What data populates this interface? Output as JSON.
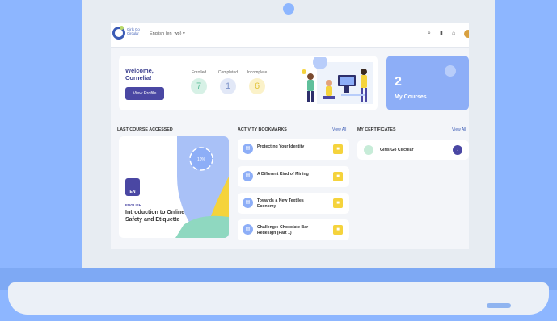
{
  "header": {
    "logo_text": "Girls Go Circular",
    "language": "English (en_wp) ▾",
    "icons": [
      "search-icon",
      "bookmark-icon",
      "bell-icon",
      "avatar"
    ]
  },
  "welcome": {
    "title": "Welcome, Cornelia!",
    "profile_button": "View Profile",
    "stats": [
      {
        "label": "Enrolled",
        "value": "7",
        "color": "#d7f1e6",
        "text_color": "#5fbf9b"
      },
      {
        "label": "Completed",
        "value": "1",
        "color": "#e2e8f7",
        "text_color": "#7c93c8"
      },
      {
        "label": "Incomplete",
        "value": "6",
        "color": "#fbf2c9",
        "text_color": "#e0c238"
      }
    ]
  },
  "my_courses": {
    "count": "2",
    "label": "My Courses"
  },
  "last_course": {
    "section_title": "LAST COURSE ACCESSED",
    "progress": "10%",
    "badge": "EN",
    "language": "ENGLISH",
    "title": "Introduction to Online Safety and Etiquette"
  },
  "bookmarks": {
    "section_title": "ACTIVITY BOOKMARKS",
    "view_all": "View All",
    "items": [
      {
        "title": "Protecting Your Identity"
      },
      {
        "title": "A Different Kind of Mining"
      },
      {
        "title": "Towards a New Textiles Economy"
      },
      {
        "title": "Challenge: Chocolate Bar Redesign (Part 1)"
      }
    ]
  },
  "certificates": {
    "section_title": "MY CERTIFICATES",
    "view_all": "View All",
    "items": [
      {
        "title": "Girls Go Circular"
      }
    ]
  },
  "colors": {
    "background": "#8db6ff",
    "accent": "#4a47a3",
    "courses_card": "#8daef7",
    "bookmark_flag": "#f5d33c"
  }
}
